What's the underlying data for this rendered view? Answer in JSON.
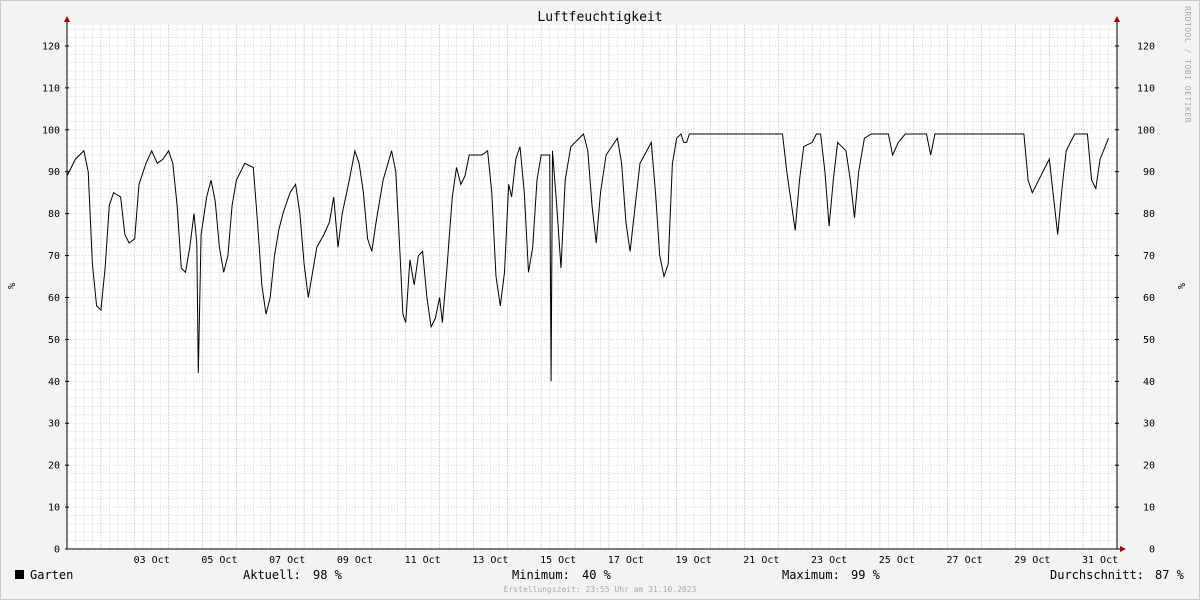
{
  "chart_data": {
    "type": "line",
    "title": "Luftfeuchtigkeit",
    "ylabel": "%",
    "ylim": [
      0,
      125
    ],
    "xlim": [
      "2023-10-01",
      "2023-11-01"
    ],
    "y_ticks": [
      0,
      10,
      20,
      30,
      40,
      50,
      60,
      70,
      80,
      90,
      100,
      110,
      120
    ],
    "x_tick_labels": [
      "03 Oct",
      "05 Oct",
      "07 Oct",
      "09 Oct",
      "11 Oct",
      "13 Oct",
      "15 Oct",
      "17 Oct",
      "19 Oct",
      "21 Oct",
      "23 Oct",
      "25 Oct",
      "27 Oct",
      "29 Oct",
      "31 Oct"
    ],
    "x_tick_dates": [
      "2023-10-03",
      "2023-10-05",
      "2023-10-07",
      "2023-10-09",
      "2023-10-11",
      "2023-10-13",
      "2023-10-15",
      "2023-10-17",
      "2023-10-19",
      "2023-10-21",
      "2023-10-23",
      "2023-10-25",
      "2023-10-27",
      "2023-10-29",
      "2023-10-31"
    ],
    "grid": true,
    "series": [
      {
        "name": "Garten",
        "color": "#000000",
        "points": [
          [
            "2023-10-01 00:00",
            89
          ],
          [
            "2023-10-01 06:00",
            93
          ],
          [
            "2023-10-01 12:00",
            95
          ],
          [
            "2023-10-01 15:00",
            90
          ],
          [
            "2023-10-01 18:00",
            68
          ],
          [
            "2023-10-01 21:00",
            58
          ],
          [
            "2023-10-02 00:00",
            57
          ],
          [
            "2023-10-02 03:00",
            67
          ],
          [
            "2023-10-02 06:00",
            82
          ],
          [
            "2023-10-02 09:00",
            85
          ],
          [
            "2023-10-02 14:00",
            84
          ],
          [
            "2023-10-02 17:00",
            75
          ],
          [
            "2023-10-02 20:00",
            73
          ],
          [
            "2023-10-03 00:00",
            74
          ],
          [
            "2023-10-03 03:00",
            87
          ],
          [
            "2023-10-03 08:00",
            92
          ],
          [
            "2023-10-03 12:00",
            95
          ],
          [
            "2023-10-03 16:00",
            92
          ],
          [
            "2023-10-03 20:00",
            93
          ],
          [
            "2023-10-04 00:00",
            95
          ],
          [
            "2023-10-04 03:00",
            92
          ],
          [
            "2023-10-04 06:00",
            82
          ],
          [
            "2023-10-04 09:00",
            67
          ],
          [
            "2023-10-04 12:00",
            66
          ],
          [
            "2023-10-04 15:00",
            72
          ],
          [
            "2023-10-04 18:00",
            80
          ],
          [
            "2023-10-04 20:00",
            73
          ],
          [
            "2023-10-04 21:00",
            42
          ],
          [
            "2023-10-04 23:00",
            75
          ],
          [
            "2023-10-05 03:00",
            84
          ],
          [
            "2023-10-05 06:00",
            88
          ],
          [
            "2023-10-05 09:00",
            83
          ],
          [
            "2023-10-05 12:00",
            72
          ],
          [
            "2023-10-05 15:00",
            66
          ],
          [
            "2023-10-05 18:00",
            70
          ],
          [
            "2023-10-05 21:00",
            82
          ],
          [
            "2023-10-06 00:00",
            88
          ],
          [
            "2023-10-06 06:00",
            92
          ],
          [
            "2023-10-06 12:00",
            91
          ],
          [
            "2023-10-06 15:00",
            78
          ],
          [
            "2023-10-06 18:00",
            63
          ],
          [
            "2023-10-06 21:00",
            56
          ],
          [
            "2023-10-07 00:00",
            60
          ],
          [
            "2023-10-07 03:00",
            70
          ],
          [
            "2023-10-07 06:00",
            76
          ],
          [
            "2023-10-07 09:00",
            80
          ],
          [
            "2023-10-07 14:00",
            85
          ],
          [
            "2023-10-07 18:00",
            87
          ],
          [
            "2023-10-07 21:00",
            80
          ],
          [
            "2023-10-08 00:00",
            68
          ],
          [
            "2023-10-08 03:00",
            60
          ],
          [
            "2023-10-08 06:00",
            66
          ],
          [
            "2023-10-08 09:00",
            72
          ],
          [
            "2023-10-08 14:00",
            75
          ],
          [
            "2023-10-08 18:00",
            78
          ],
          [
            "2023-10-08 21:00",
            84
          ],
          [
            "2023-10-09 00:00",
            72
          ],
          [
            "2023-10-09 03:00",
            80
          ],
          [
            "2023-10-09 08:00",
            88
          ],
          [
            "2023-10-09 12:00",
            95
          ],
          [
            "2023-10-09 15:00",
            92
          ],
          [
            "2023-10-09 18:00",
            85
          ],
          [
            "2023-10-09 21:00",
            74
          ],
          [
            "2023-10-10 00:00",
            71
          ],
          [
            "2023-10-10 03:00",
            78
          ],
          [
            "2023-10-10 08:00",
            88
          ],
          [
            "2023-10-10 14:00",
            95
          ],
          [
            "2023-10-10 17:00",
            90
          ],
          [
            "2023-10-10 20:00",
            70
          ],
          [
            "2023-10-10 22:00",
            56
          ],
          [
            "2023-10-11 00:00",
            54
          ],
          [
            "2023-10-11 03:00",
            69
          ],
          [
            "2023-10-11 06:00",
            63
          ],
          [
            "2023-10-11 09:00",
            70
          ],
          [
            "2023-10-11 12:00",
            71
          ],
          [
            "2023-10-11 15:00",
            60
          ],
          [
            "2023-10-11 18:00",
            53
          ],
          [
            "2023-10-11 21:00",
            55
          ],
          [
            "2023-10-12 00:00",
            60
          ],
          [
            "2023-10-12 02:00",
            54
          ],
          [
            "2023-10-12 05:00",
            66
          ],
          [
            "2023-10-12 09:00",
            84
          ],
          [
            "2023-10-12 12:00",
            91
          ],
          [
            "2023-10-12 15:00",
            87
          ],
          [
            "2023-10-12 18:00",
            89
          ],
          [
            "2023-10-12 21:00",
            94
          ],
          [
            "2023-10-13 06:00",
            94
          ],
          [
            "2023-10-13 10:00",
            95
          ],
          [
            "2023-10-13 13:00",
            85
          ],
          [
            "2023-10-13 16:00",
            65
          ],
          [
            "2023-10-13 19:00",
            58
          ],
          [
            "2023-10-13 22:00",
            66
          ],
          [
            "2023-10-14 01:00",
            87
          ],
          [
            "2023-10-14 03:00",
            84
          ],
          [
            "2023-10-14 06:00",
            93
          ],
          [
            "2023-10-14 09:00",
            96
          ],
          [
            "2023-10-14 12:00",
            85
          ],
          [
            "2023-10-14 15:00",
            66
          ],
          [
            "2023-10-14 18:00",
            72
          ],
          [
            "2023-10-14 21:00",
            88
          ],
          [
            "2023-10-15 00:00",
            94
          ],
          [
            "2023-10-15 06:00",
            94
          ],
          [
            "2023-10-15 07:00",
            40
          ],
          [
            "2023-10-15 08:00",
            95
          ],
          [
            "2023-10-15 11:00",
            82
          ],
          [
            "2023-10-15 14:00",
            67
          ],
          [
            "2023-10-15 17:00",
            88
          ],
          [
            "2023-10-15 21:00",
            96
          ],
          [
            "2023-10-16 06:00",
            99
          ],
          [
            "2023-10-16 09:00",
            95
          ],
          [
            "2023-10-16 12:00",
            82
          ],
          [
            "2023-10-16 15:00",
            73
          ],
          [
            "2023-10-16 18:00",
            85
          ],
          [
            "2023-10-16 22:00",
            94
          ],
          [
            "2023-10-17 06:00",
            98
          ],
          [
            "2023-10-17 09:00",
            92
          ],
          [
            "2023-10-17 12:00",
            78
          ],
          [
            "2023-10-17 15:00",
            71
          ],
          [
            "2023-10-17 18:00",
            80
          ],
          [
            "2023-10-17 22:00",
            92
          ],
          [
            "2023-10-18 06:00",
            97
          ],
          [
            "2023-10-18 09:00",
            85
          ],
          [
            "2023-10-18 12:00",
            70
          ],
          [
            "2023-10-18 15:00",
            65
          ],
          [
            "2023-10-18 18:00",
            68
          ],
          [
            "2023-10-18 21:00",
            92
          ],
          [
            "2023-10-19 00:00",
            98
          ],
          [
            "2023-10-19 03:00",
            99
          ],
          [
            "2023-10-19 05:00",
            97
          ],
          [
            "2023-10-19 07:00",
            97
          ],
          [
            "2023-10-19 09:00",
            99
          ],
          [
            "2023-10-22 03:00",
            99
          ],
          [
            "2023-10-22 06:00",
            90
          ],
          [
            "2023-10-22 09:00",
            83
          ],
          [
            "2023-10-22 12:00",
            76
          ],
          [
            "2023-10-22 15:00",
            88
          ],
          [
            "2023-10-22 18:00",
            96
          ],
          [
            "2023-10-23 00:00",
            97
          ],
          [
            "2023-10-23 03:00",
            99
          ],
          [
            "2023-10-23 06:00",
            99
          ],
          [
            "2023-10-23 09:00",
            90
          ],
          [
            "2023-10-23 12:00",
            77
          ],
          [
            "2023-10-23 15:00",
            88
          ],
          [
            "2023-10-23 18:00",
            97
          ],
          [
            "2023-10-24 00:00",
            95
          ],
          [
            "2023-10-24 03:00",
            88
          ],
          [
            "2023-10-24 06:00",
            79
          ],
          [
            "2023-10-24 09:00",
            90
          ],
          [
            "2023-10-24 13:00",
            98
          ],
          [
            "2023-10-24 18:00",
            99
          ],
          [
            "2023-10-25 06:00",
            99
          ],
          [
            "2023-10-25 09:00",
            94
          ],
          [
            "2023-10-25 13:00",
            97
          ],
          [
            "2023-10-25 18:00",
            99
          ],
          [
            "2023-10-26 09:00",
            99
          ],
          [
            "2023-10-26 12:00",
            94
          ],
          [
            "2023-10-26 15:00",
            99
          ],
          [
            "2023-10-28 21:00",
            99
          ],
          [
            "2023-10-29 06:00",
            99
          ],
          [
            "2023-10-29 09:00",
            88
          ],
          [
            "2023-10-29 12:00",
            85
          ],
          [
            "2023-10-29 15:00",
            87
          ],
          [
            "2023-10-29 21:00",
            91
          ],
          [
            "2023-10-30 00:00",
            93
          ],
          [
            "2023-10-30 03:00",
            84
          ],
          [
            "2023-10-30 06:00",
            75
          ],
          [
            "2023-10-30 09:00",
            86
          ],
          [
            "2023-10-30 12:00",
            95
          ],
          [
            "2023-10-30 18:00",
            99
          ],
          [
            "2023-10-31 00:00",
            99
          ],
          [
            "2023-10-31 03:00",
            99
          ],
          [
            "2023-10-31 06:00",
            88
          ],
          [
            "2023-10-31 09:00",
            86
          ],
          [
            "2023-10-31 12:00",
            93
          ],
          [
            "2023-10-31 18:00",
            98
          ]
        ]
      }
    ]
  },
  "watermark": "RRDTOOL / TOBI OETIKER",
  "legend": {
    "series_name": "Garten",
    "current_label": "Aktuell:",
    "current_value": "98 %",
    "min_label": "Minimum:",
    "min_value": "40 %",
    "max_label": "Maximum:",
    "max_value": "99 %",
    "avg_label": "Durchschnitt:",
    "avg_value": "87 %"
  },
  "footer": "Erstellungszeit: 23:55 Uhr am 31.10.2023"
}
